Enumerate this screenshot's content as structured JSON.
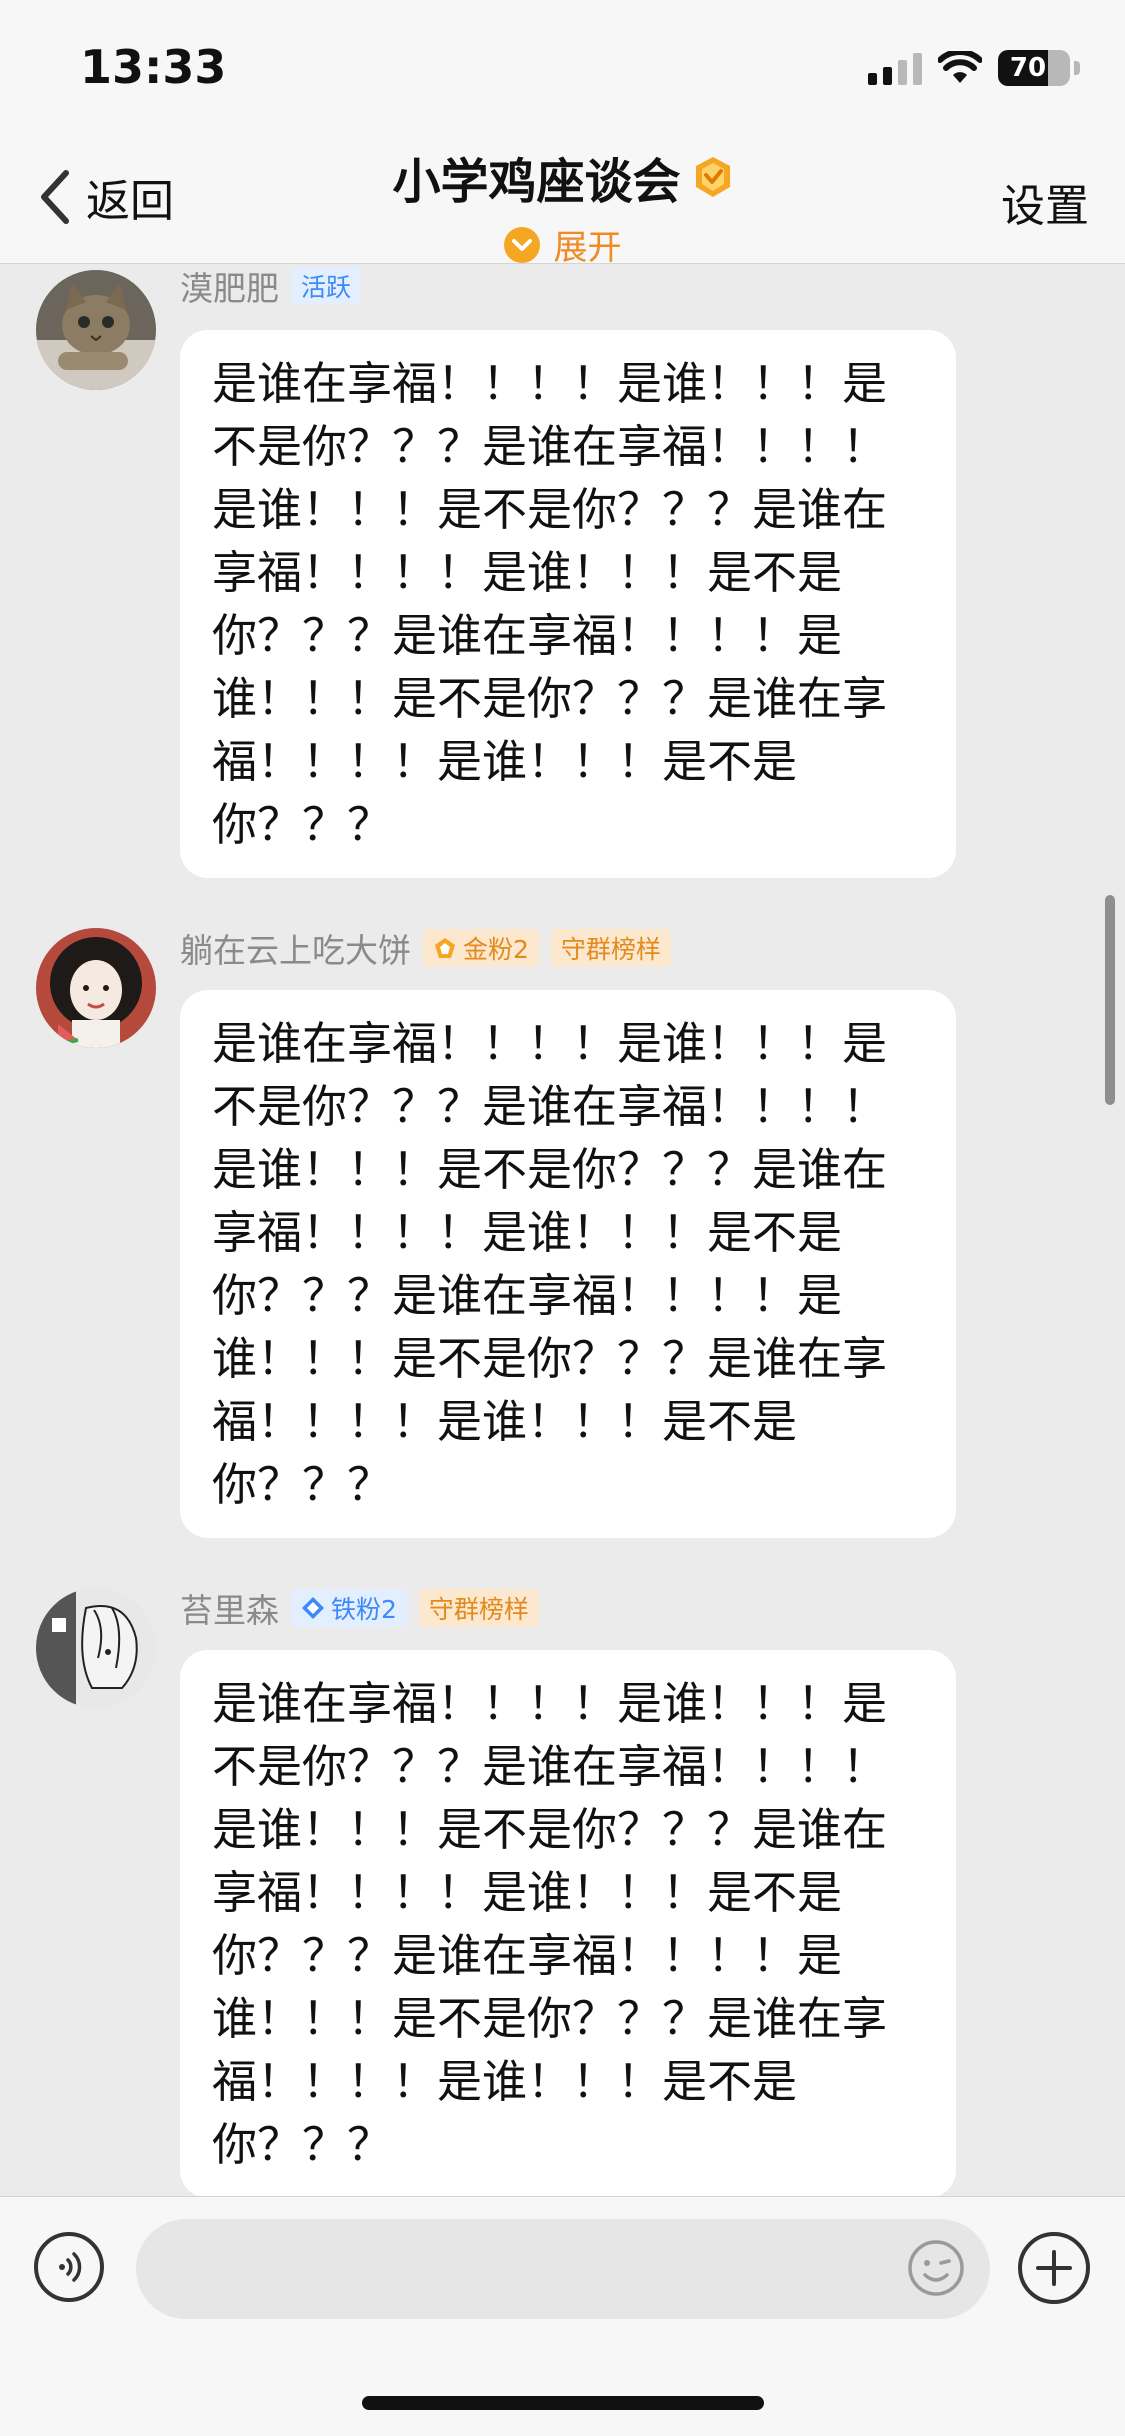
{
  "status_bar": {
    "time": "13:33",
    "battery": "70",
    "battery_level": 0.7
  },
  "nav": {
    "back_label": "返回",
    "title": "小学鸡座谈会",
    "expand_label": "展开",
    "settings_label": "设置"
  },
  "messages": [
    {
      "sender": "漠肥肥",
      "badges": [
        "活跃"
      ],
      "text": "是谁在享福！！！！是谁！！！是不是你？？？是谁在享福！！！！是谁！！！是不是你？？？是谁在享福！！！！是谁！！！是不是你？？？是谁在享福！！！！是谁！！！是不是你？？？是谁在享福！！！！是谁！！！是不是你？？？"
    },
    {
      "sender": "躺在云上吃大饼",
      "badges": [
        "金粉2",
        "守群榜样"
      ],
      "text": "是谁在享福！！！！是谁！！！是不是你？？？是谁在享福！！！！是谁！！！是不是你？？？是谁在享福！！！！是谁！！！是不是你？？？是谁在享福！！！！是谁！！！是不是你？？？是谁在享福！！！！是谁！！！是不是你？？？"
    },
    {
      "sender": "苔里森",
      "badges": [
        "铁粉2",
        "守群榜样"
      ],
      "text": "是谁在享福！！！！是谁！！！是不是你？？？是谁在享福！！！！是谁！！！是不是你？？？是谁在享福！！！！是谁！！！是不是你？？？是谁在享福！！！！是谁！！！是不是你？？？是谁在享福！！！！是谁！！！是不是你？？？"
    }
  ],
  "input": {
    "placeholder": ""
  },
  "colors": {
    "accent": "#f08a24",
    "bubble": "#ffffff",
    "background": "#ebebeb"
  }
}
